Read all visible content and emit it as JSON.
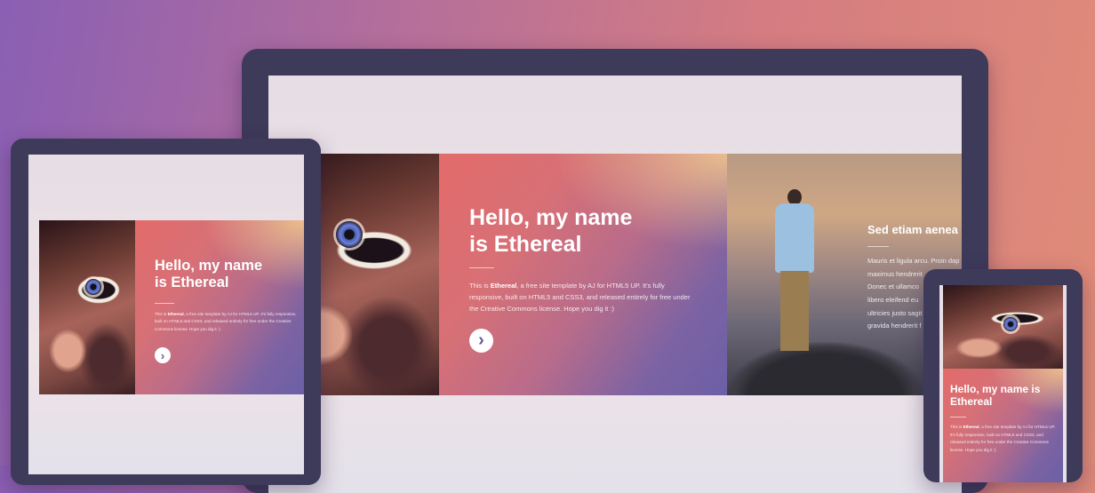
{
  "hero": {
    "title_line1": "Hello, my name",
    "title_line2": "is Ethereal",
    "body_prefix": "This is ",
    "body_bold": "Ethereal",
    "body_rest": ", a free site template by AJ for HTML5 UP. It's fully responsive, built on HTML5 and CSS3, and released entirely for free under the Creative Commons license. Hope you dig it :)",
    "next_icon": "›"
  },
  "phone_hero": {
    "title_line1": "Hello, my name is",
    "title_line2": "Ethereal"
  },
  "secondary": {
    "title": "Sed etiam aenea",
    "body": "Mauris et ligula arcu. Proin dap\nmaximus hendrerit\nDonec et ullamco\nlibero eleifend eu\nultricies justo sagit\ngravida hendrerit f"
  }
}
